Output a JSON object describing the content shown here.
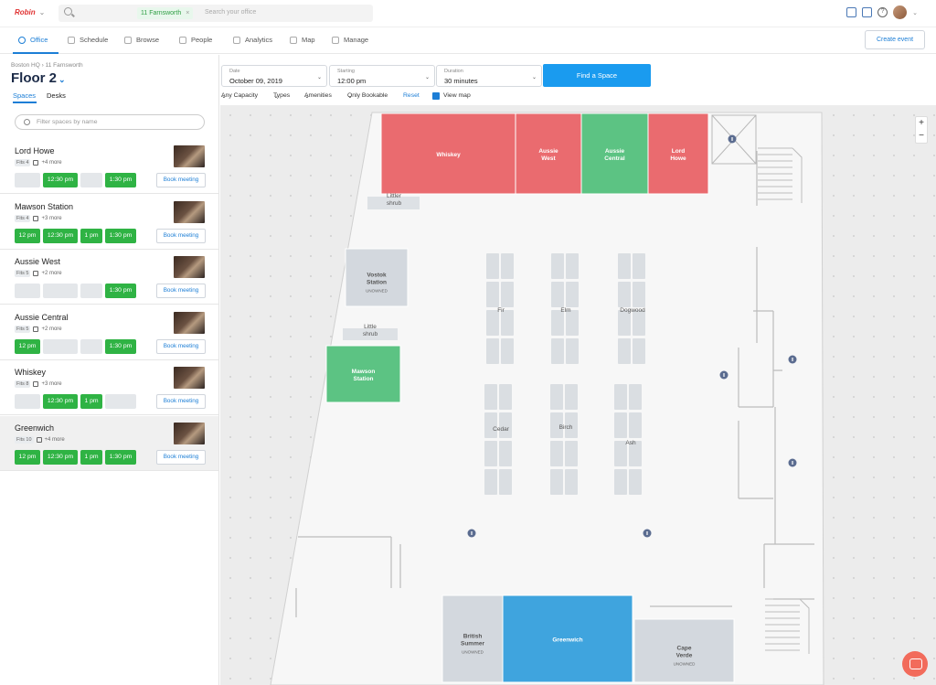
{
  "app": {
    "brand": "Robin",
    "search_chip": "11 Farnsworth",
    "search_placeholder": "Search your office"
  },
  "nav": {
    "items": [
      "Office",
      "Schedule",
      "Browse",
      "People",
      "Analytics",
      "Map",
      "Manage"
    ],
    "active": "Office",
    "create_event": "Create event"
  },
  "left": {
    "breadcrumb": "Boston HQ › 11 Farnsworth",
    "floor_title": "Floor 2",
    "tabs": [
      "Spaces",
      "Desks"
    ],
    "filter_placeholder": "Filter spaces by name",
    "book_label": "Book meeting",
    "spaces": [
      {
        "name": "Lord Howe",
        "fits": "Fits 4",
        "more": "+4 more",
        "slots": [
          [
            "",
            false
          ],
          [
            "12:30 pm",
            true
          ],
          [
            "",
            false
          ],
          [
            "1:30 pm",
            true
          ]
        ]
      },
      {
        "name": "Mawson Station",
        "fits": "Fits 4",
        "more": "+3 more",
        "slots": [
          [
            "12 pm",
            true
          ],
          [
            "12:30 pm",
            true
          ],
          [
            "1 pm",
            true
          ],
          [
            "1:30 pm",
            true
          ]
        ]
      },
      {
        "name": "Aussie West",
        "fits": "Fits 5",
        "more": "+2 more",
        "slots": [
          [
            "",
            false
          ],
          [
            "",
            false
          ],
          [
            "",
            false
          ],
          [
            "1:30 pm",
            true
          ]
        ]
      },
      {
        "name": "Aussie Central",
        "fits": "Fits 5",
        "more": "+2 more",
        "slots": [
          [
            "12 pm",
            true
          ],
          [
            "",
            false
          ],
          [
            "",
            false
          ],
          [
            "1:30 pm",
            true
          ]
        ]
      },
      {
        "name": "Whiskey",
        "fits": "Fits 8",
        "more": "+3 more",
        "slots": [
          [
            "",
            false
          ],
          [
            "12:30 pm",
            true
          ],
          [
            "1 pm",
            true
          ],
          [
            "",
            false
          ]
        ]
      },
      {
        "name": "Greenwich",
        "fits": "Fits 10",
        "more": "+4 more",
        "slots": [
          [
            "12 pm",
            true
          ],
          [
            "12:30 pm",
            true
          ],
          [
            "1 pm",
            true
          ],
          [
            "1:30 pm",
            true
          ]
        ]
      }
    ]
  },
  "search": {
    "date_label": "Date",
    "date_value": "October 09, 2019",
    "start_label": "Starting",
    "start_value": "12:00 pm",
    "duration_label": "Duration",
    "duration_value": "30 minutes",
    "find_button": "Find a Space",
    "filters": [
      "Any Capacity",
      "Types",
      "Amenities",
      "Only Bookable"
    ],
    "reset": "Reset",
    "view_map": "View map"
  },
  "map": {
    "rooms": [
      {
        "name": "Whiskey",
        "status": "busy"
      },
      {
        "name": "Aussie\nWest",
        "status": "busy"
      },
      {
        "name": "Aussie\nCentral",
        "status": "free"
      },
      {
        "name": "Lord\nHowe",
        "status": "busy"
      },
      {
        "name": "Mawson\nStation",
        "status": "free"
      },
      {
        "name": "Vostok\nStation",
        "sub": "UNOWNED",
        "status": "none"
      },
      {
        "name": "Greenwich",
        "status": "selected"
      },
      {
        "name": "British\nSummer",
        "sub": "UNOWNED",
        "status": "none"
      },
      {
        "name": "Cape\nVerde",
        "sub": "UNOWNED",
        "status": "none"
      }
    ],
    "labels": [
      "Littler\nshrub",
      "Little\nshrub",
      "Fir",
      "Elm",
      "Dogwood",
      "Cedar",
      "Birch",
      "Ash"
    ],
    "colors": {
      "busy": "#ea6b6f",
      "free": "#5cc383",
      "selected": "#3fa4de",
      "none": "#d3d8de",
      "accent": "#1c7ed6"
    }
  },
  "zoom": {
    "plus": "+",
    "minus": "−"
  }
}
